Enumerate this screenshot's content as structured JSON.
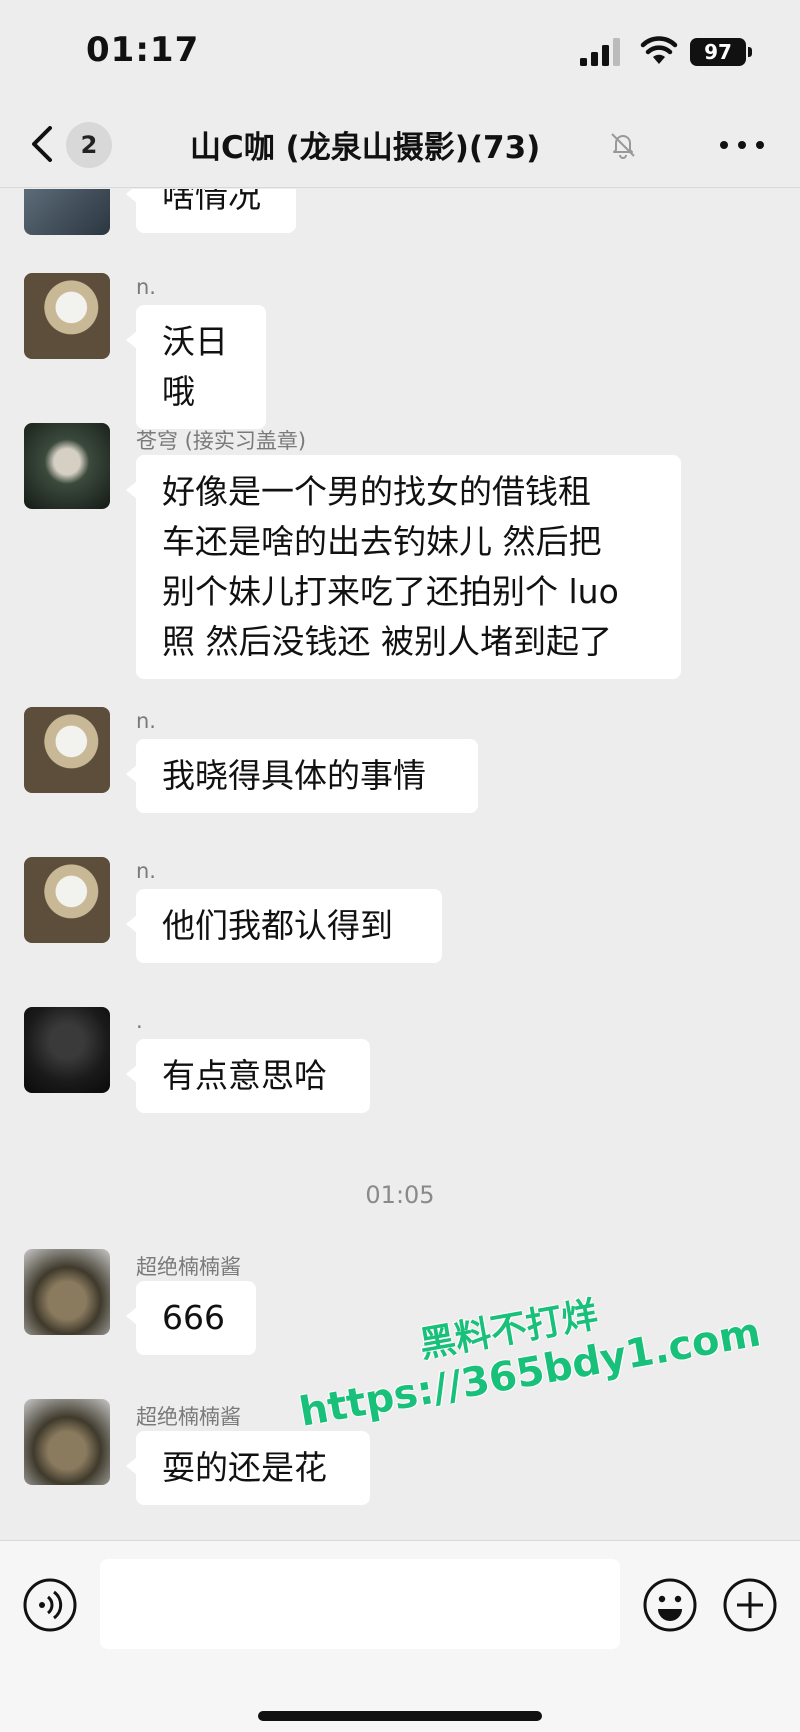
{
  "status_bar": {
    "time": "01:17",
    "battery": "97"
  },
  "header": {
    "unread_count": "2",
    "title": "山C咖 (龙泉山摄影)(73)"
  },
  "messages": [
    {
      "sender": "",
      "text": "啥情况"
    },
    {
      "sender": "n.",
      "text": "沃日哦"
    },
    {
      "sender": "苍穹 (接实习盖章)",
      "lines": [
        "好像是一个男的找女的借钱租",
        "车还是啥的出去钓妹儿  然后把",
        "别个妹儿打来吃了还拍别个 luo",
        "照 然后没钱还 被别人堵到起了"
      ]
    },
    {
      "sender": "n.",
      "text": "我晓得具体的事情"
    },
    {
      "sender": "n.",
      "text": "他们我都认得到"
    },
    {
      "sender": ".",
      "text": "有点意思哈"
    },
    {
      "sender": "超绝楠楠酱",
      "text": "666"
    },
    {
      "sender": "超绝楠楠酱",
      "text": "耍的还是花"
    }
  ],
  "timestamp": "01:05",
  "watermark": {
    "line1": "黑料不打烊",
    "line2": "https://365bdy1.com"
  },
  "icons": {
    "back": "chevron-left-icon",
    "mute": "bell-off-icon",
    "more": "more-horizontal-icon",
    "voice": "voice-icon",
    "emoji": "smiley-icon",
    "plus": "plus-circle-icon"
  },
  "colors": {
    "background": "#ededed",
    "bubble": "#ffffff",
    "watermark": "#19c07a"
  }
}
